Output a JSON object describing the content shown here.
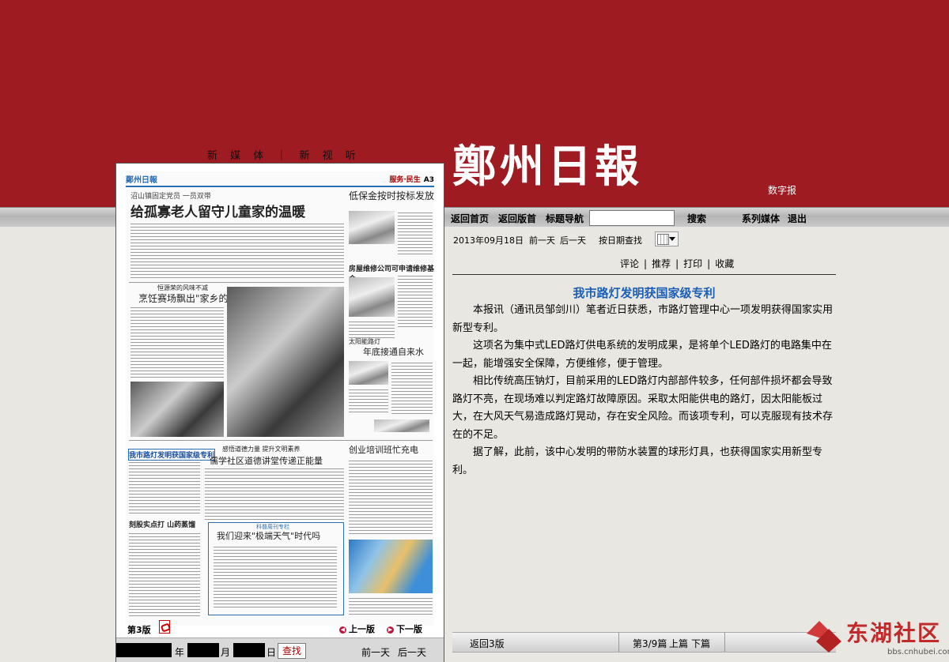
{
  "header": {
    "new_media": "新 媒 体 ｜ 新 视 听",
    "logo": "鄭州日報",
    "digital": "数字报"
  },
  "topnav": {
    "home": "返回首页",
    "back_section": "返回版首",
    "title_nav": "标题导航",
    "search": "搜索",
    "media_series": "系列媒体",
    "exit": "退出"
  },
  "subnav": {
    "date": "2013年09月18日",
    "prev_day": "前一天",
    "next_day": "后一天",
    "find_by_date": "按日期查找"
  },
  "actions": {
    "comment": "评论",
    "recommend": "推荐",
    "print": "打印",
    "favorite": "收藏"
  },
  "article": {
    "title": "我市路灯发明获国家级专利",
    "paragraphs": [
      "本报讯（通讯员邹剑川）笔者近日获悉，市路灯管理中心一项发明获得国家实用新型专利。",
      "这项名为集中式LED路灯供电系统的发明成果，是将单个LED路灯的电路集中在一起，能增强安全保障，方便维修，便于管理。",
      "相比传统高压钠灯，目前采用的LED路灯内部部件较多，任何部件损坏都会导致路灯不亮，在现场难以判定路灯故障原因。采取太阳能供电的路灯，因太阳能板过大，在大风天气易造成路灯晃动，存在安全风险。而该项专利，可以克服现有技术存在的不足。",
      "据了解，此前，该中心发明的带防水装置的球形灯具，也获得国家实用新型专利。"
    ]
  },
  "bottombar": {
    "back": "返回3版",
    "page": "第3/9篇",
    "prev": "上篇",
    "next": "下篇"
  },
  "paper": {
    "brand": "鄭州日報",
    "section": "服务·民生",
    "page_code": "A3",
    "head_kicker": "沼山镇固定党员 一员双带",
    "head_main": "给孤寡老人留守儿童家的温暖",
    "side1": "低保金按时按标发放",
    "mid_kicker": "恒源荣的风味不减",
    "mid_head": "烹饪赛场飘出\"家乡的味道\"",
    "side2": "房屋维修公司可申请维修基金",
    "side3_kicker": "太阳能路灯",
    "side3": "年底接通自来水",
    "left3": "我市路灯发明获国家级专利",
    "center3_kicker": "感悟道德力量 提升文明素养",
    "center3": "儒学社区道德讲堂传递正能量",
    "right3": "创业培训班忙充电",
    "left4": "刻股实点打 山药蒸馏",
    "box_kicker": "科普周刊专栏",
    "box_head": "我们迎来\"极端天气\"时代吗",
    "page_label": "第3版",
    "prev": "上一版",
    "next": "下一版"
  },
  "datebar": {
    "year": "年",
    "month": "月",
    "day": "日",
    "find": "查找",
    "prev_day": "前一天",
    "next_day": "后一天"
  },
  "watermark": {
    "text": "东湖社区",
    "url": "bbs.cnhubei.com"
  }
}
